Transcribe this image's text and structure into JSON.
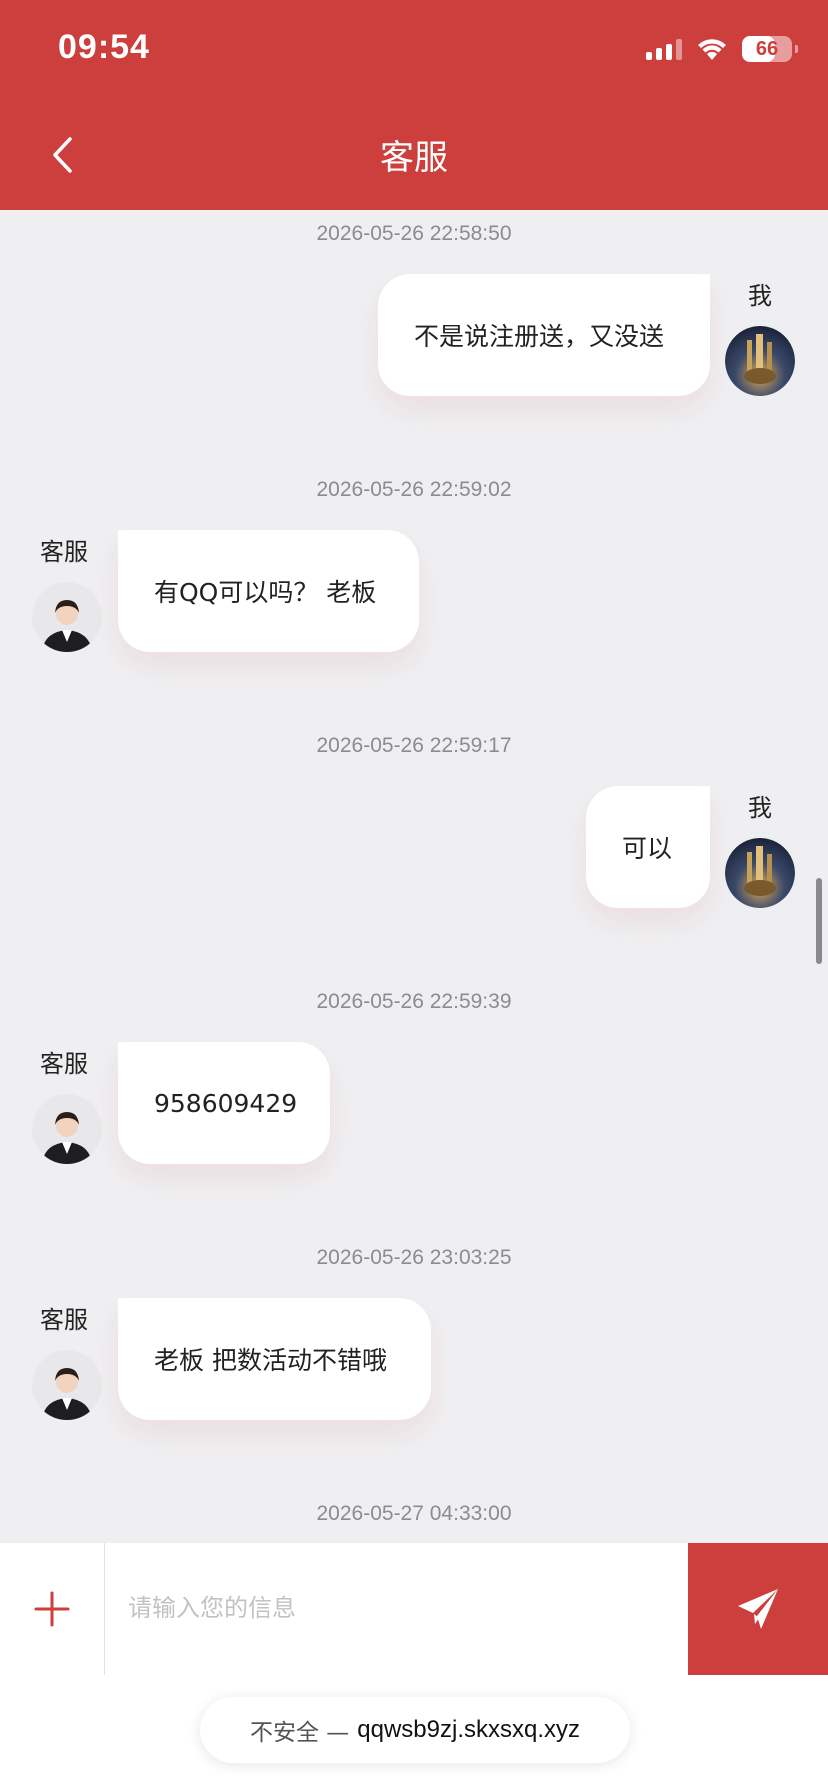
{
  "status_bar": {
    "time": "09:54",
    "battery": "66",
    "battery_level": 0.66
  },
  "header": {
    "title": "客服"
  },
  "chat": {
    "messages": [
      {
        "timestamp": "2026-05-26 22:58:50",
        "sender": "我",
        "text": "不是说注册送，又没送"
      },
      {
        "timestamp": "2026-05-26 22:59:02",
        "sender": "客服",
        "text": "有QQ可以吗？ 老板"
      },
      {
        "timestamp": "2026-05-26 22:59:17",
        "sender": "我",
        "text": "可以"
      },
      {
        "timestamp": "2026-05-26 22:59:39",
        "sender": "客服",
        "text": "958609429"
      },
      {
        "timestamp": "2026-05-26 23:03:25",
        "sender": "客服",
        "text": "老板 把数活动不错哦"
      },
      {
        "timestamp": "2026-05-27 04:33:00"
      }
    ]
  },
  "input": {
    "placeholder": "请输入您的信息"
  },
  "browser": {
    "insecure_label": "不安全 —",
    "host": "qqwsb9zj.skxsxq.xyz"
  },
  "colors": {
    "brand": "#cc3f3c",
    "background": "#efeff1"
  },
  "icons": [
    "back-chevron-icon",
    "plus-icon",
    "send-icon",
    "signal-icon",
    "wifi-icon",
    "battery-icon"
  ]
}
